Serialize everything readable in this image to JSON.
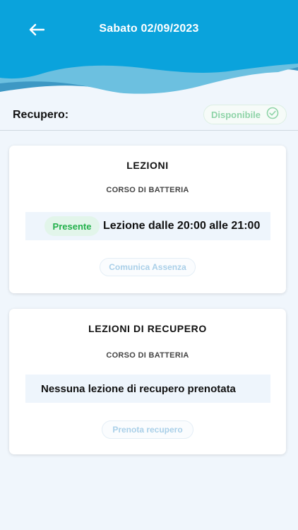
{
  "header": {
    "title": "Sabato 02/09/2023",
    "back_icon": "arrow-left-icon"
  },
  "recupero": {
    "label": "Recupero:",
    "status": "Disponibile",
    "status_icon": "check-circle-icon"
  },
  "lezioni": {
    "title": "LEZIONI",
    "course": "CORSO DI BATTERIA",
    "lesson": {
      "badge": "Presente",
      "text": "Lezione dalle 20:00 alle 21:00"
    },
    "action": "Comunica Assenza"
  },
  "recupero_card": {
    "title": "LEZIONI DI RECUPERO",
    "course": "CORSO DI BATTERIA",
    "empty": "Nessuna lezione di recupero prenotata",
    "action": "Prenota recupero"
  },
  "colors": {
    "header_blue": "#0aa3dc",
    "wave_light": "#6cc0e0",
    "wave_mid": "#3d98c4",
    "present_green": "#22b04a",
    "available_green": "#8fd4a8",
    "disabled_blue": "#a9cfe8"
  }
}
